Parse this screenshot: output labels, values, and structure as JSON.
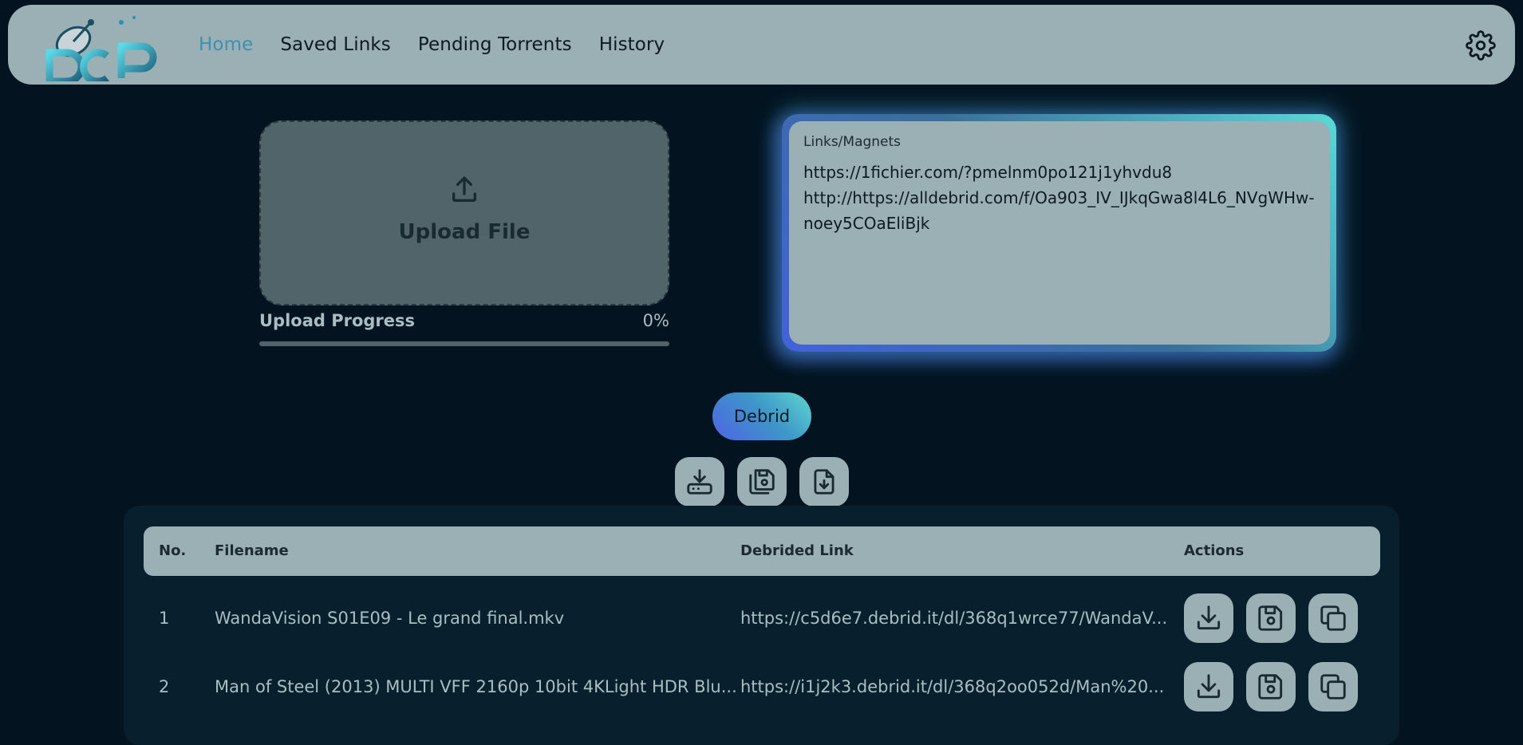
{
  "nav": {
    "items": [
      {
        "label": "Home",
        "active": true
      },
      {
        "label": "Saved Links",
        "active": false
      },
      {
        "label": "Pending Torrents",
        "active": false
      },
      {
        "label": "History",
        "active": false
      }
    ],
    "settings_icon": "gear-icon"
  },
  "upload": {
    "label": "Upload File",
    "icon": "upload-icon",
    "progress_label": "Upload Progress",
    "progress_value": "0%",
    "progress_fraction": 0
  },
  "links": {
    "label": "Links/Magnets",
    "value": "https://1fichier.com/?pmelnm0po121j1yhvdu8\nhttp://https://alldebrid.com/f/Oa903_IV_IJkqGwa8l4L6_NVgWHw-noey5COaEliBjk"
  },
  "debrid_button": "Debrid",
  "toolbar": {
    "icons": [
      "download-to-device-icon",
      "save-all-icon",
      "download-file-icon"
    ]
  },
  "table": {
    "headers": [
      "No.",
      "Filename",
      "Debrided Link",
      "Actions"
    ],
    "rows": [
      {
        "no": "1",
        "filename": "WandaVision S01E09 - Le grand final.mkv",
        "link": "https://c5d6e7.debrid.it/dl/368q1wrce77/WandaV..."
      },
      {
        "no": "2",
        "filename": "Man of Steel (2013) MULTI VFF 2160p 10bit 4KLight HDR Blu...",
        "link": "https://i1j2k3.debrid.it/dl/368q2oo052d/Man%20..."
      }
    ],
    "row_actions": [
      "download-icon",
      "save-icon",
      "copy-icon"
    ]
  },
  "colors": {
    "background": "#031420",
    "panel": "#9ab0b4",
    "accent": "#3d8fb4"
  }
}
